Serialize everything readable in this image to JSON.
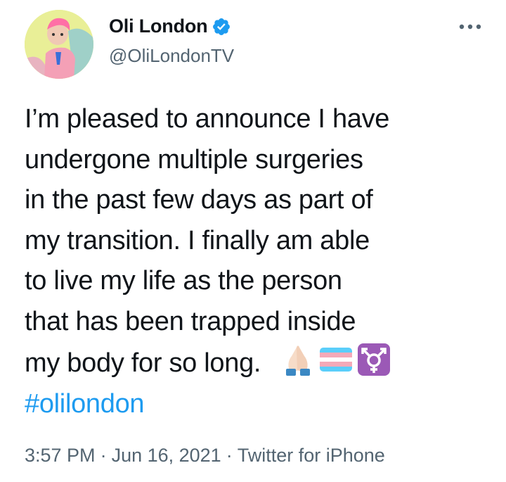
{
  "author": {
    "display_name": "Oli London",
    "handle": "@OliLondonTV",
    "verified": true,
    "avatar_icon": "profile-photo"
  },
  "menu_icon": "more-options-icon",
  "tweet": {
    "lines": [
      "I’m pleased to announce I have",
      "undergone multiple surgeries",
      "in the past few days as part of",
      "my transition. I finally am able",
      "to live my life as the person",
      "that has been trapped inside",
      "my body for so long."
    ],
    "emojis": [
      "folded-hands-emoji",
      "transgender-flag-emoji",
      "transgender-symbol-emoji"
    ],
    "hashtag": "#olilondon"
  },
  "meta": {
    "time": "3:57 PM",
    "separator": "·",
    "date": "Jun 16, 2021",
    "source": "Twitter for iPhone"
  },
  "colors": {
    "text": "#0f1419",
    "secondary": "#536471",
    "link": "#1d9bf0",
    "verified": "#1d9bf0"
  }
}
